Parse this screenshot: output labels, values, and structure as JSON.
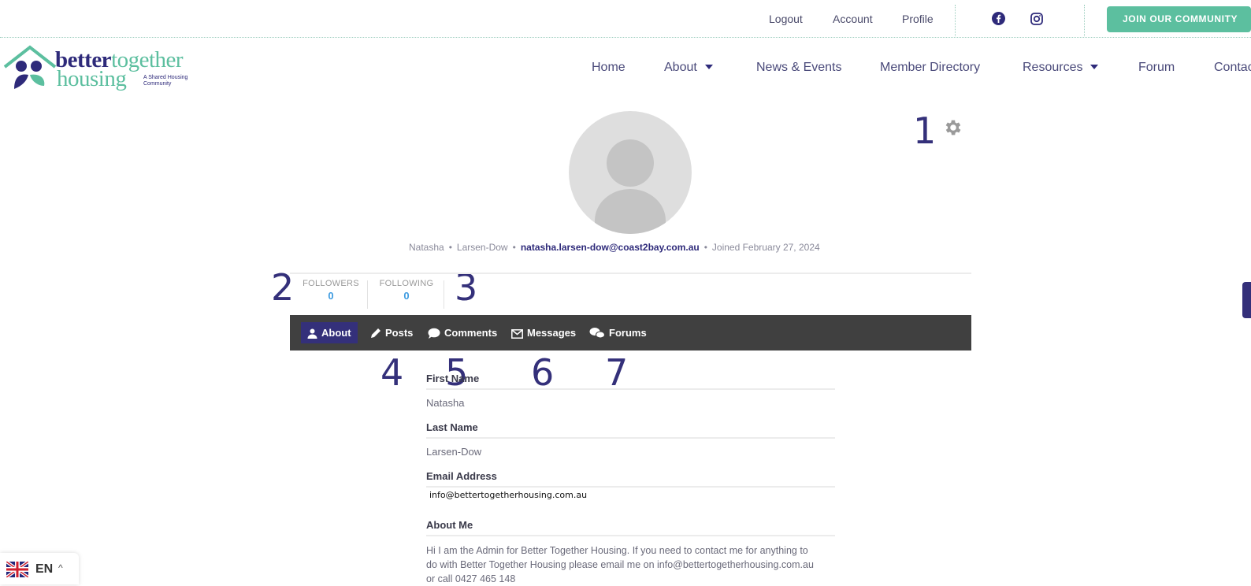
{
  "topbar": {
    "logout": "Logout",
    "account": "Account",
    "profile": "Profile",
    "facebook_icon": "facebook-icon",
    "instagram_icon": "instagram-icon",
    "join_button": "JOIN OUR COMMUNITY"
  },
  "logo": {
    "word_better": "better",
    "word_together": "together",
    "word_housing": "housing",
    "tagline": "A Shared Housing Community"
  },
  "nav": {
    "home": "Home",
    "about": "About",
    "news_events": "News & Events",
    "member_directory": "Member Directory",
    "resources": "Resources",
    "forum": "Forum",
    "contact": "Contac"
  },
  "annotations": [
    "1",
    "2",
    "3",
    "4",
    "5",
    "6",
    "7"
  ],
  "profile": {
    "first_name": "Natasha",
    "last_name": "Larsen-Dow",
    "email": "natasha.larsen-dow@coast2bay.com.au",
    "joined": "Joined February 27, 2024",
    "separator": "•"
  },
  "stats": {
    "followers_label": "FOLLOWERS",
    "followers_value": "0",
    "following_label": "FOLLOWING",
    "following_value": "0"
  },
  "tabs": {
    "about": "About",
    "posts": "Posts",
    "comments": "Comments",
    "messages": "Messages",
    "forums": "Forums"
  },
  "fields": {
    "first_name_label": "First Name",
    "first_name_value": "Natasha",
    "last_name_label": "Last Name",
    "last_name_value": "Larsen-Dow",
    "email_label": "Email Address",
    "email_value": "info@bettertogetherhousing.com.au",
    "about_label": "About Me",
    "about_value": "Hi I am the Admin for Better Together Housing. If you need to contact me for anything to do with Better Together Housing please email me on info@bettertogetherhousing.com.au or call 0427 465 148"
  },
  "language": {
    "code": "EN",
    "caret": "^",
    "flag_icon": "uk-flag-icon"
  },
  "colors": {
    "brand_purple": "#34307a",
    "brand_green": "#5cbf9f",
    "tabbar_bg": "#404040",
    "stat_value": "#3d9be0"
  }
}
